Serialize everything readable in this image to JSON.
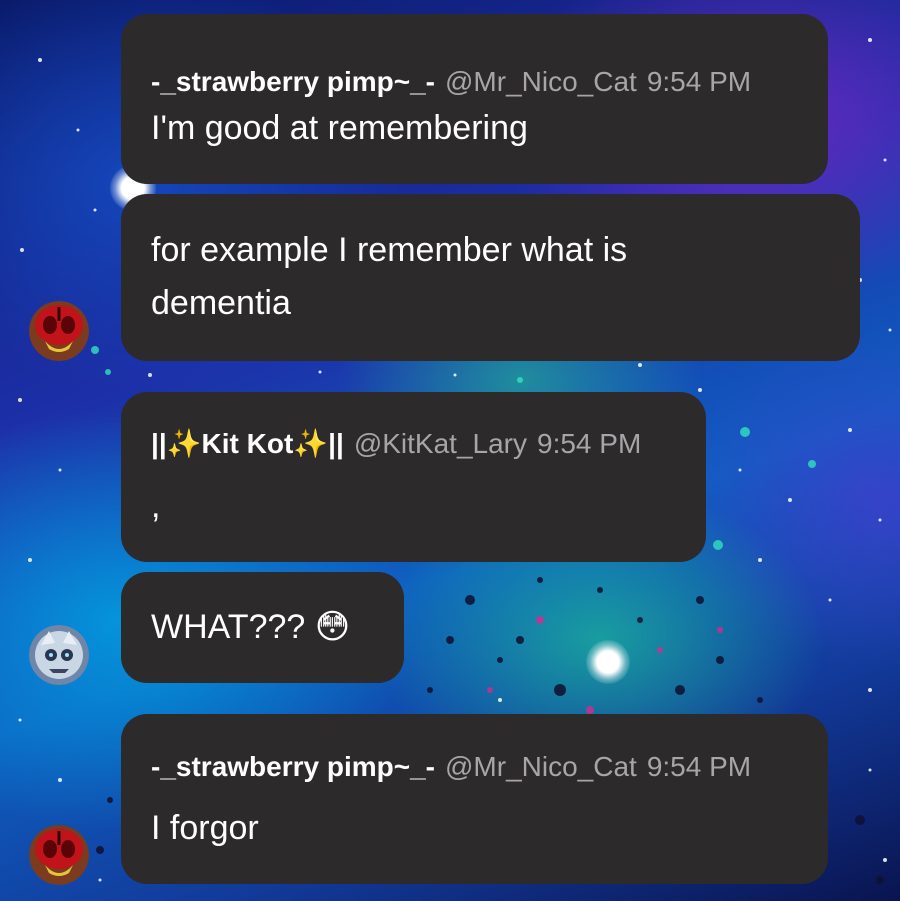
{
  "colors": {
    "bubble": "#2d2a2b",
    "username": "#ffffff",
    "meta": "#a7a5a7",
    "text": "#ffffff"
  },
  "messages": [
    {
      "username": "-_strawberry pimp~_-",
      "handle": "@Mr_Nico_Cat",
      "time": "9:54 PM",
      "text": "I'm good at remembering"
    },
    {
      "text_line1": "for example I remember what is",
      "text_line2": "dementia",
      "avatar_icon": "strawberry-avatar-icon"
    },
    {
      "username": "||✨Kit Kot✨||",
      "handle": "@KitKat_Lary",
      "time": "9:54 PM",
      "text": ","
    },
    {
      "text": "WHAT??? 😳",
      "avatar_icon": "kitkat-avatar-icon"
    },
    {
      "username": "-_strawberry pimp~_-",
      "handle": "@Mr_Nico_Cat",
      "time": "9:54 PM",
      "text": "I forgor",
      "avatar_icon": "strawberry-avatar-icon"
    }
  ]
}
